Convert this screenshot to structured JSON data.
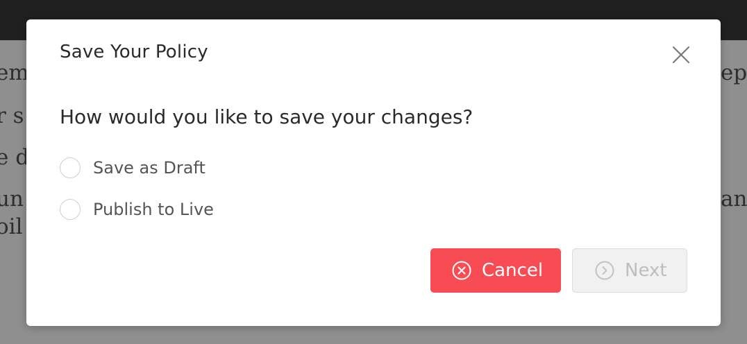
{
  "background": {
    "left_fragments": [
      "em",
      "r s",
      "e d",
      "un",
      "oil"
    ],
    "right_fragments": [
      "ep",
      "",
      "",
      "an",
      ""
    ]
  },
  "modal": {
    "title": "Save Your Policy",
    "close_icon": "close-icon",
    "question": "How would you like to save your changes?",
    "options": [
      {
        "label": "Save as Draft",
        "selected": false
      },
      {
        "label": "Publish to Live",
        "selected": false
      }
    ],
    "buttons": {
      "cancel": {
        "label": "Cancel",
        "icon": "circle-x-icon",
        "color": "#f84c55"
      },
      "next": {
        "label": "Next",
        "icon": "circle-chevron-right-icon",
        "disabled": true
      }
    }
  }
}
